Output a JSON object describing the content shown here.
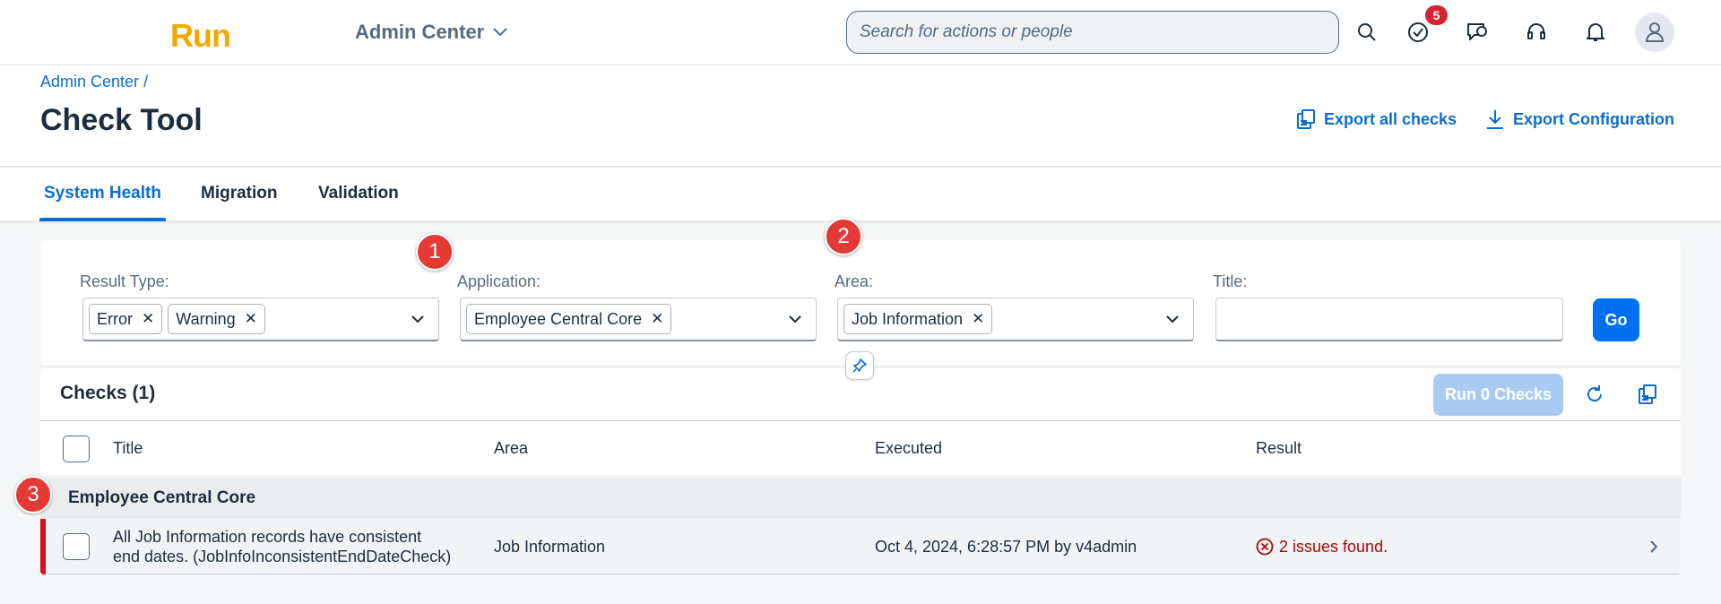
{
  "shell": {
    "logo": "Run",
    "product": "Admin Center",
    "search_placeholder": "Search for actions or people",
    "notification_badge": "5",
    "icons": [
      "search-icon",
      "tasks-icon",
      "chat-icon",
      "support-icon",
      "bell-icon",
      "user-icon"
    ]
  },
  "header": {
    "breadcrumb": "Admin Center",
    "breadcrumb_sep": "/",
    "title": "Check Tool",
    "export_all_label": "Export all checks",
    "export_config_label": "Export Configuration"
  },
  "tabs": [
    {
      "label": "System Health",
      "active": true
    },
    {
      "label": "Migration",
      "active": false
    },
    {
      "label": "Validation",
      "active": false
    }
  ],
  "filters": {
    "result_type": {
      "label": "Result Type:",
      "tokens": [
        "Error",
        "Warning"
      ]
    },
    "application": {
      "label": "Application:",
      "tokens": [
        "Employee Central Core"
      ]
    },
    "area": {
      "label": "Area:",
      "tokens": [
        "Job Information"
      ]
    },
    "title": {
      "label": "Title:",
      "value": ""
    },
    "go_label": "Go"
  },
  "table": {
    "title": "Checks (1)",
    "run_label": "Run 0 Checks",
    "columns": [
      "Title",
      "Area",
      "Executed",
      "Result"
    ],
    "group": "Employee Central Core",
    "rows": [
      {
        "title_line1": "All Job Information records have consistent",
        "title_line2": "end dates. (JobInfoInconsistentEndDateCheck)",
        "area": "Job Information",
        "executed": "Oct 4, 2024, 6:28:57 PM by v4admin",
        "result": "2 issues found."
      }
    ]
  },
  "markers": [
    "1",
    "2",
    "3"
  ],
  "colors": {
    "accent": "#0a6ed1",
    "brand_logo": "#f0ab00",
    "error": "#aa0808",
    "marker": "#e53935"
  }
}
